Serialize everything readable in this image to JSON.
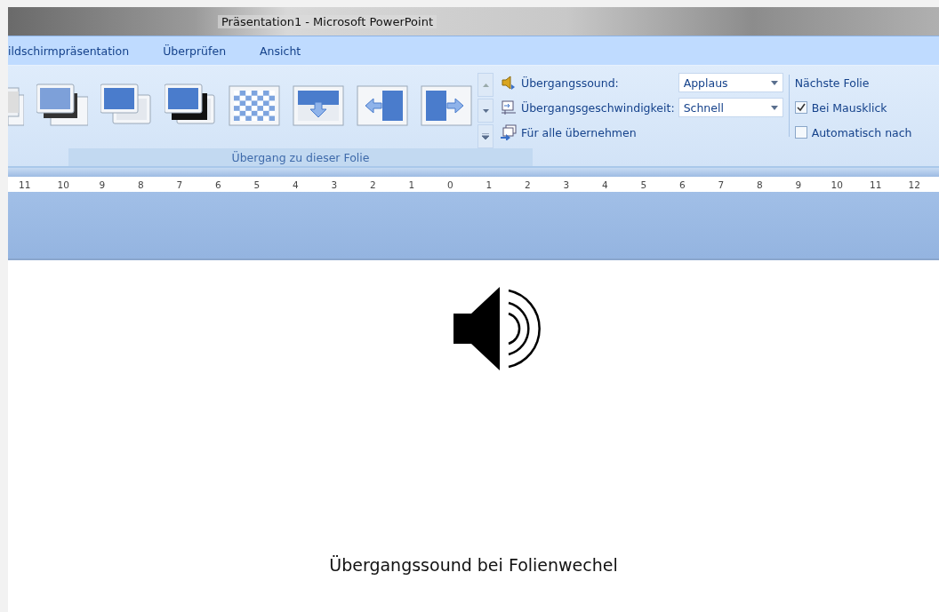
{
  "window": {
    "title": "Präsentation1 - Microsoft PowerPoint"
  },
  "tabs": [
    {
      "label": "ildschirmpräsentation"
    },
    {
      "label": "Überprüfen"
    },
    {
      "label": "Ansicht"
    }
  ],
  "transition": {
    "sound": {
      "label": "Übergangssound:",
      "value": "Applaus"
    },
    "speed": {
      "label": "Übergangsgeschwindigkeit:",
      "value": "Schnell"
    },
    "apply_all": "Für alle übernehmen",
    "group_label": "Übergang zu dieser Folie"
  },
  "next_slide": {
    "title": "Nächste Folie",
    "options": [
      {
        "label": "Bei Mausklick",
        "checked": true
      },
      {
        "label": "Automatisch nach",
        "checked": false
      }
    ]
  },
  "ruler": [
    "11",
    "10",
    "9",
    "8",
    "7",
    "6",
    "5",
    "4",
    "3",
    "2",
    "1",
    "0",
    "1",
    "2",
    "3",
    "4",
    "5",
    "6",
    "7",
    "8",
    "9",
    "10",
    "11",
    "12"
  ],
  "slide": {
    "caption": "Übergangssound bei Folienwechel"
  }
}
